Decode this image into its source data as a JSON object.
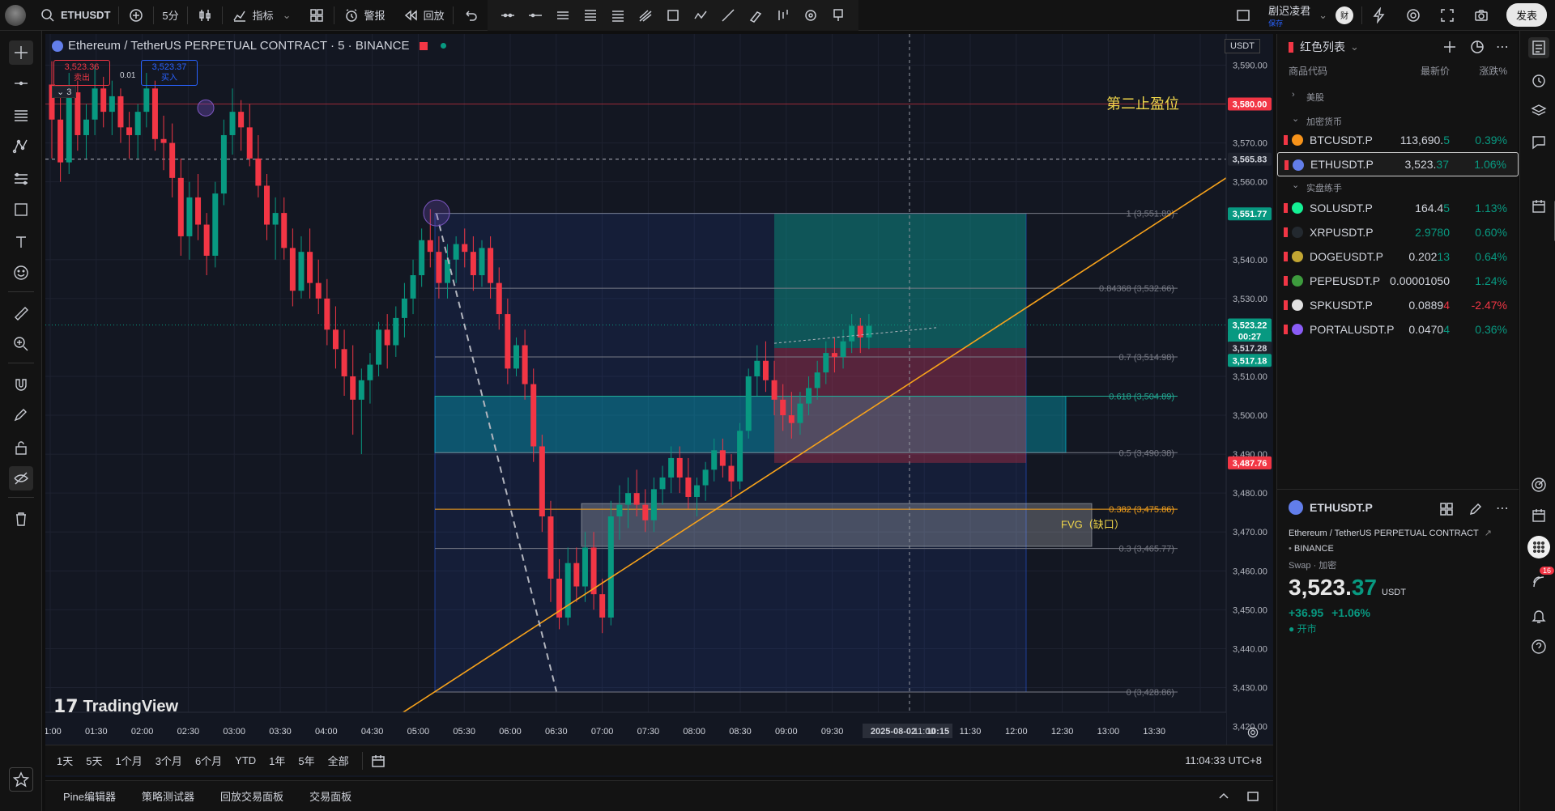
{
  "topbar": {
    "symbol": "ETHUSDT",
    "interval": "5分",
    "indicators": "指标",
    "alert": "警报",
    "replay": "回放",
    "user_name": "剧迟凌君",
    "user_sub": "保存",
    "publish": "发表"
  },
  "legend": {
    "title": "Ethereum / TetherUS PERPETUAL CONTRACT · 5 · BINANCE",
    "sell_price": "3,523.36",
    "sell_label": "卖出",
    "spread": "0.01",
    "buy_price": "3,523.37",
    "buy_label": "买入",
    "collapse_count": "3"
  },
  "currency": "USDT",
  "watermark": "TradingView",
  "annotations": {
    "take_profit_label": "第二止盈位",
    "fvg_label": "FVG（缺口）"
  },
  "fib_levels": [
    {
      "label": "1 (3,551.89)",
      "price": 3551.89,
      "color": "#787b86"
    },
    {
      "label": "0.84368 (3,532.66)",
      "price": 3532.66,
      "color": "#787b86"
    },
    {
      "label": "0.7 (3,514.98)",
      "price": 3514.98,
      "color": "#787b86"
    },
    {
      "label": "0.618 (3,504.89)",
      "price": 3504.89,
      "color": "#22ab94"
    },
    {
      "label": "0.5 (3,490.38)",
      "price": 3490.38,
      "color": "#787b86"
    },
    {
      "label": "0.382 (3,475.86)",
      "price": 3475.86,
      "color": "#f7a21b"
    },
    {
      "label": "0.3 (3,465.77)",
      "price": 3465.77,
      "color": "#787b86"
    },
    {
      "label": "0 (3,428.86)",
      "price": 3428.86,
      "color": "#787b86"
    }
  ],
  "price_axis": {
    "ticks": [
      "3,590.00",
      "3,570.00",
      "3,560.00",
      "3,540.00",
      "3,530.00",
      "3,510.00",
      "3,500.00",
      "3,490.00",
      "3,480.00",
      "3,470.00",
      "3,460.00",
      "3,450.00",
      "3,440.00",
      "3,430.00",
      "3,420.00"
    ],
    "badges": [
      {
        "text": "3,580.00",
        "price": 3580.0,
        "bg": "#f23645",
        "fg": "#ffffff"
      },
      {
        "text": "3,565.83",
        "price": 3565.83,
        "bg": "#1e222d",
        "fg": "#d1d4dc"
      },
      {
        "text": "3,551.77",
        "price": 3551.77,
        "bg": "#089981",
        "fg": "#ffffff"
      },
      {
        "text": "3,523.22",
        "price": 3523.22,
        "bg": "#089981",
        "fg": "#ffffff"
      },
      {
        "text": "00:27",
        "price": 3520.3,
        "bg": "#089981",
        "fg": "#ffffff"
      },
      {
        "text": "3,517.28",
        "price": 3517.28,
        "bg": "#1e222d",
        "fg": "#d1d4dc"
      },
      {
        "text": "3,517.18",
        "price": 3514.1,
        "bg": "#089981",
        "fg": "#ffffff"
      },
      {
        "text": "3,487.76",
        "price": 3487.76,
        "bg": "#f23645",
        "fg": "#ffffff"
      }
    ]
  },
  "time_axis": {
    "labels": [
      "01:00",
      "01:30",
      "02:00",
      "02:30",
      "03:00",
      "03:30",
      "04:00",
      "04:30",
      "05:00",
      "05:30",
      "06:00",
      "06:30",
      "07:00",
      "07:30",
      "08:00",
      "08:30",
      "09:00",
      "09:30",
      "2025-08-02",
      "10:15",
      "11:00",
      "11:30",
      "12:00",
      "12:30",
      "13:00",
      "13:30"
    ]
  },
  "bottombar": {
    "ranges": [
      "1天",
      "5天",
      "1个月",
      "3个月",
      "6个月",
      "YTD",
      "1年",
      "5年",
      "全部"
    ],
    "clock": "11:04:33 UTC+8"
  },
  "footer": {
    "tabs": [
      "Pine编辑器",
      "策略测试器",
      "回放交易面板",
      "交易面板"
    ]
  },
  "watchlist": {
    "title": "红色列表",
    "col_symbol": "商品代码",
    "col_last": "最新价",
    "col_change": "涨跌%",
    "groups": {
      "stocks": "美股",
      "crypto": "加密货币",
      "practice": "实盘练手"
    },
    "items_crypto": [
      {
        "symbol": "BTCUSDT.P",
        "price_main": "113,690.",
        "price_tail": "5",
        "change": "0.39%",
        "up": true,
        "coin": "#f7931a"
      },
      {
        "symbol": "ETHUSDT.P",
        "price_main": "3,523.",
        "price_tail": "37",
        "change": "1.06%",
        "up": true,
        "coin": "#627eea"
      }
    ],
    "items_practice": [
      {
        "symbol": "SOLUSDT.P",
        "price_main": "164.4",
        "price_tail": "5",
        "change": "1.13%",
        "up": true,
        "coin": "#14f195"
      },
      {
        "symbol": "XRPUSDT.P",
        "price_main": "2.9780",
        "price_tail": "",
        "change": "0.60%",
        "up": true,
        "coin": "#23292f"
      },
      {
        "symbol": "DOGEUSDT.P",
        "price_main": "0.202",
        "price_tail": "13",
        "change": "0.64%",
        "up": true,
        "coin": "#c2a633"
      },
      {
        "symbol": "PEPEUSDT.P",
        "price_main": "0.00001050",
        "price_tail": "",
        "change": "1.24%",
        "up": true,
        "coin": "#3d9b3d"
      },
      {
        "symbol": "SPKUSDT.P",
        "price_main": "0.0889",
        "price_tail": "4",
        "change": "-2.47%",
        "up": false,
        "coin": "#e0e0e0"
      },
      {
        "symbol": "PORTALUSDT.P",
        "price_main": "0.0470",
        "price_tail": "4",
        "change": "0.36%",
        "up": true,
        "coin": "#8a5cf6"
      }
    ]
  },
  "details": {
    "symbol": "ETHUSDT.P",
    "name": "Ethereum / TetherUS PERPETUAL CONTRACT",
    "exchange": "BINANCE",
    "type": "Swap · 加密",
    "price_main": "3,523.",
    "price_tail": "37",
    "currency": "USDT",
    "change": "+36.95",
    "change_pct": "+1.06%",
    "status": "开市",
    "notif_count": "16"
  },
  "colors": {
    "up": "#089981",
    "down": "#f23645",
    "accent": "#2962ff",
    "fib_line": "#f7a21b"
  },
  "chart_data": {
    "type": "candlestick",
    "title": "Ethereum / TetherUS PERPETUAL CONTRACT · 5 · BINANCE",
    "ylim": [
      3417,
      3598
    ],
    "candles": [
      [
        3585,
        3591,
        3566,
        3576
      ],
      [
        3576,
        3582,
        3560,
        3565
      ],
      [
        3565,
        3588,
        3562,
        3583
      ],
      [
        3583,
        3586,
        3568,
        3572
      ],
      [
        3572,
        3580,
        3566,
        3576
      ],
      [
        3576,
        3590,
        3572,
        3584
      ],
      [
        3584,
        3587,
        3574,
        3578
      ],
      [
        3578,
        3586,
        3572,
        3582
      ],
      [
        3582,
        3584,
        3570,
        3574
      ],
      [
        3574,
        3578,
        3566,
        3572
      ],
      [
        3572,
        3580,
        3566,
        3578
      ],
      [
        3578,
        3588,
        3574,
        3584
      ],
      [
        3584,
        3586,
        3568,
        3571
      ],
      [
        3571,
        3577,
        3563,
        3570
      ],
      [
        3570,
        3575,
        3556,
        3561
      ],
      [
        3561,
        3566,
        3541,
        3546
      ],
      [
        3546,
        3560,
        3540,
        3556
      ],
      [
        3556,
        3562,
        3545,
        3549
      ],
      [
        3549,
        3552,
        3536,
        3541
      ],
      [
        3541,
        3560,
        3538,
        3557
      ],
      [
        3557,
        3576,
        3554,
        3572
      ],
      [
        3572,
        3584,
        3567,
        3578
      ],
      [
        3578,
        3581,
        3568,
        3574
      ],
      [
        3574,
        3580,
        3564,
        3566
      ],
      [
        3566,
        3572,
        3556,
        3559
      ],
      [
        3559,
        3562,
        3545,
        3549
      ],
      [
        3549,
        3556,
        3540,
        3552
      ],
      [
        3552,
        3556,
        3540,
        3543
      ],
      [
        3543,
        3548,
        3528,
        3532
      ],
      [
        3532,
        3546,
        3530,
        3542
      ],
      [
        3542,
        3548,
        3530,
        3534
      ],
      [
        3534,
        3540,
        3526,
        3530
      ],
      [
        3530,
        3535,
        3518,
        3522
      ],
      [
        3522,
        3528,
        3512,
        3517
      ],
      [
        3517,
        3522,
        3505,
        3510
      ],
      [
        3510,
        3518,
        3495,
        3504
      ],
      [
        3504,
        3512,
        3490,
        3509
      ],
      [
        3509,
        3516,
        3503,
        3513
      ],
      [
        3513,
        3524,
        3510,
        3522
      ],
      [
        3522,
        3526,
        3512,
        3518
      ],
      [
        3518,
        3528,
        3515,
        3525
      ],
      [
        3525,
        3534,
        3520,
        3530
      ],
      [
        3530,
        3540,
        3526,
        3536
      ],
      [
        3536,
        3548,
        3533,
        3545
      ],
      [
        3545,
        3553,
        3538,
        3542
      ],
      [
        3542,
        3546,
        3530,
        3534
      ],
      [
        3534,
        3544,
        3530,
        3540
      ],
      [
        3540,
        3546,
        3534,
        3544
      ],
      [
        3544,
        3548,
        3538,
        3542
      ],
      [
        3542,
        3546,
        3532,
        3536
      ],
      [
        3536,
        3545,
        3533,
        3543
      ],
      [
        3543,
        3546,
        3530,
        3534
      ],
      [
        3534,
        3538,
        3522,
        3526
      ],
      [
        3526,
        3530,
        3508,
        3512
      ],
      [
        3512,
        3520,
        3510,
        3518
      ],
      [
        3518,
        3522,
        3504,
        3508
      ],
      [
        3508,
        3512,
        3488,
        3492
      ],
      [
        3492,
        3495,
        3470,
        3474
      ],
      [
        3474,
        3478,
        3452,
        3458
      ],
      [
        3458,
        3463,
        3445,
        3448
      ],
      [
        3448,
        3466,
        3446,
        3462
      ],
      [
        3462,
        3466,
        3452,
        3456
      ],
      [
        3456,
        3470,
        3452,
        3466
      ],
      [
        3466,
        3470,
        3450,
        3454
      ],
      [
        3454,
        3458,
        3444,
        3448
      ],
      [
        3448,
        3478,
        3446,
        3474
      ],
      [
        3474,
        3482,
        3468,
        3477
      ],
      [
        3477,
        3484,
        3471,
        3480
      ],
      [
        3480,
        3486,
        3474,
        3477
      ],
      [
        3477,
        3481,
        3470,
        3473
      ],
      [
        3473,
        3484,
        3470,
        3481
      ],
      [
        3481,
        3487,
        3477,
        3484
      ],
      [
        3484,
        3492,
        3480,
        3489
      ],
      [
        3489,
        3492,
        3480,
        3484
      ],
      [
        3484,
        3489,
        3476,
        3479
      ],
      [
        3479,
        3484,
        3474,
        3482
      ],
      [
        3482,
        3488,
        3478,
        3486
      ],
      [
        3486,
        3494,
        3483,
        3491
      ],
      [
        3491,
        3494,
        3484,
        3487
      ],
      [
        3487,
        3490,
        3479,
        3483
      ],
      [
        3483,
        3498,
        3481,
        3496
      ],
      [
        3496,
        3512,
        3494,
        3510
      ],
      [
        3510,
        3518,
        3505,
        3514
      ],
      [
        3514,
        3519,
        3506,
        3509
      ],
      [
        3509,
        3514,
        3500,
        3504
      ],
      [
        3504,
        3508,
        3496,
        3500
      ],
      [
        3500,
        3506,
        3494,
        3498
      ],
      [
        3498,
        3506,
        3495,
        3503
      ],
      [
        3503,
        3510,
        3500,
        3507
      ],
      [
        3507,
        3514,
        3504,
        3511
      ],
      [
        3511,
        3519,
        3508,
        3516
      ],
      [
        3516,
        3520,
        3511,
        3515
      ],
      [
        3515,
        3522,
        3512,
        3519
      ],
      [
        3519,
        3526,
        3516,
        3523
      ],
      [
        3523,
        3525,
        3516,
        3520
      ],
      [
        3520,
        3526,
        3517,
        3523
      ]
    ]
  }
}
